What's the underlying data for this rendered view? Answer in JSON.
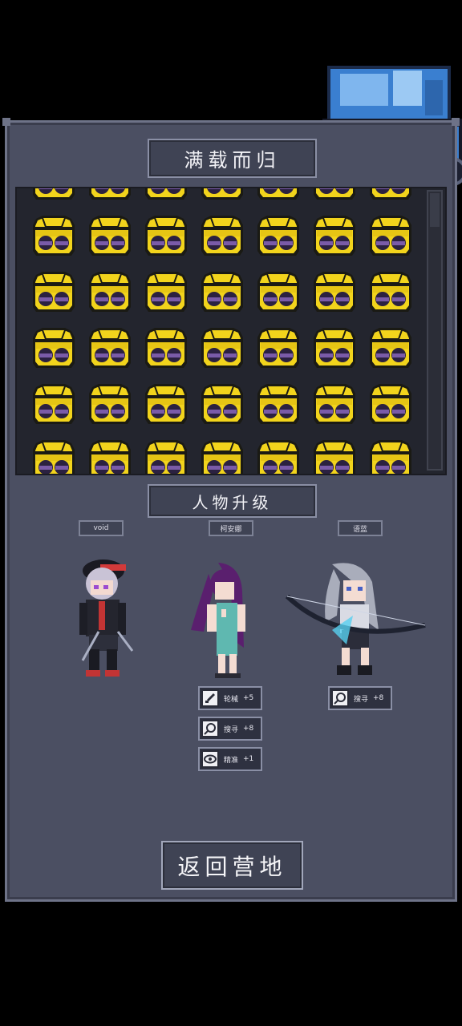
{
  "header": {
    "title": "满载而归"
  },
  "loot": {
    "item": "crate-icon",
    "columns": 7,
    "rows": 6
  },
  "upgrade": {
    "title": "人物升级",
    "characters": [
      {
        "name": "void",
        "skills": []
      },
      {
        "name": "柯安娜",
        "skills": [
          {
            "icon": "mechanics-icon",
            "label": "轮械",
            "value": "+5"
          },
          {
            "icon": "search-icon",
            "label": "搜寻",
            "value": "+8"
          },
          {
            "icon": "eye-icon",
            "label": "精准",
            "value": "+1"
          }
        ]
      },
      {
        "name": "语蓝",
        "skills": [
          {
            "icon": "search-icon",
            "label": "搜寻",
            "value": "+8"
          }
        ]
      }
    ]
  },
  "footer": {
    "return_label": "返回营地"
  },
  "colors": {
    "panel": "#4b4f62",
    "crate": "#f2d41c",
    "background": "#000000"
  }
}
